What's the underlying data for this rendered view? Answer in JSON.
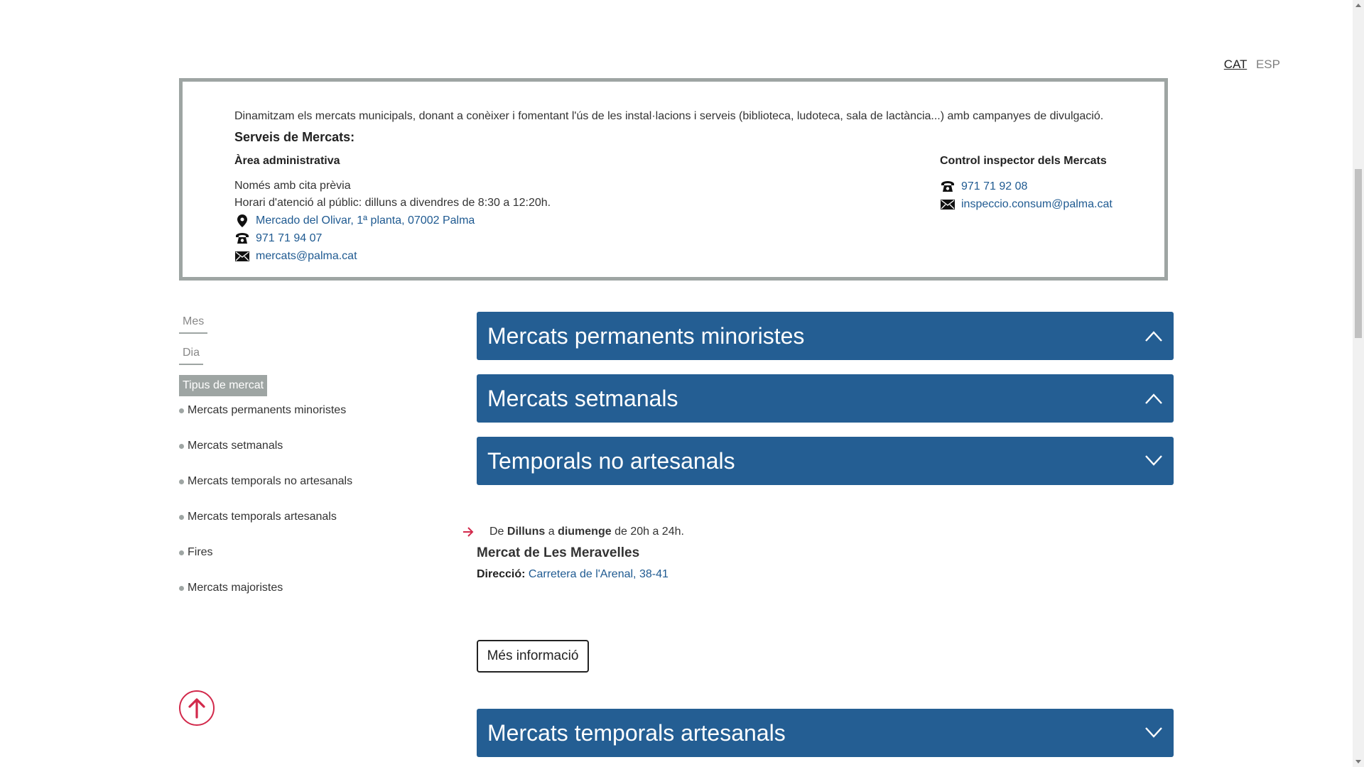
{
  "lang": {
    "cat": "CAT",
    "esp": "ESP"
  },
  "info": {
    "intro": "Dinamitzam els mercats municipals, donant a conèixer i fomentant l'ús de les instal·lacions i serveis (biblioteca, ludoteca, sala de lactància...) amb campanyes de divulgació.",
    "title": "Serveis de Mercats:",
    "area": {
      "title": "Àrea administrativa",
      "line1": "Només amb cita prèvia",
      "line2": "Horari d'atenció al públic: dilluns a divendres de 8:30 a 12:20h.",
      "address": "Mercado del Olivar, 1ª planta, 07002 Palma",
      "phone": "971 71 94 07",
      "email": "mercats@palma.cat"
    },
    "control": {
      "title": "Control inspector dels Mercats",
      "phone": "971 71 92 08",
      "email": "inspeccio.consum@palma.cat"
    }
  },
  "filters": {
    "mes": "Mes",
    "dia": "Dia",
    "tipus": "Tipus de mercat",
    "items": [
      "Mercats permanents minoristes",
      "Mercats setmanals",
      "Mercats temporals no artesanals",
      "Mercats temporals artesanals",
      "Fires",
      "Mercats majoristes"
    ]
  },
  "accordions": [
    {
      "title": "Mercats permanents minoristes",
      "state": "up"
    },
    {
      "title": "Mercats setmanals",
      "state": "up"
    },
    {
      "title": "Temporals no artesanals",
      "state": "down"
    },
    {
      "title": "Mercats temporals artesanals",
      "state": "down"
    }
  ],
  "event": {
    "de": "De",
    "from_day": "Dilluns",
    "a": "a",
    "to_day": "diumenge",
    "hours": "de 20h a 24h.",
    "name": "Mercat de Les Meravelles",
    "address_label": "Direcció:",
    "address": "Carretera de l'Arenal, 38-41",
    "more": "Més informació"
  },
  "colors": {
    "accent_blue": "#245e93",
    "link": "#1f5a91",
    "red": "#d2294b",
    "gray": "#9ea5a3"
  }
}
